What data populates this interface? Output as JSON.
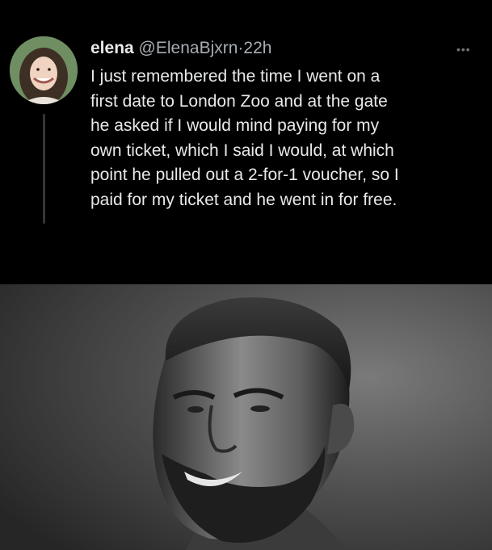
{
  "tweet": {
    "display_name": "elena",
    "handle": "@ElenaBjxrn",
    "separator": "·",
    "time": "22h",
    "more_icon": "more-dots-icon",
    "text_lines": [
      "I just remembered the time I went on a",
      "first date to London Zoo and at the gate",
      "he asked if I would mind paying for my",
      "own ticket, which I said I would, at which",
      "point he pulled out a 2-for-1 voucher, so I",
      "paid for my ticket and he went in for free."
    ]
  }
}
